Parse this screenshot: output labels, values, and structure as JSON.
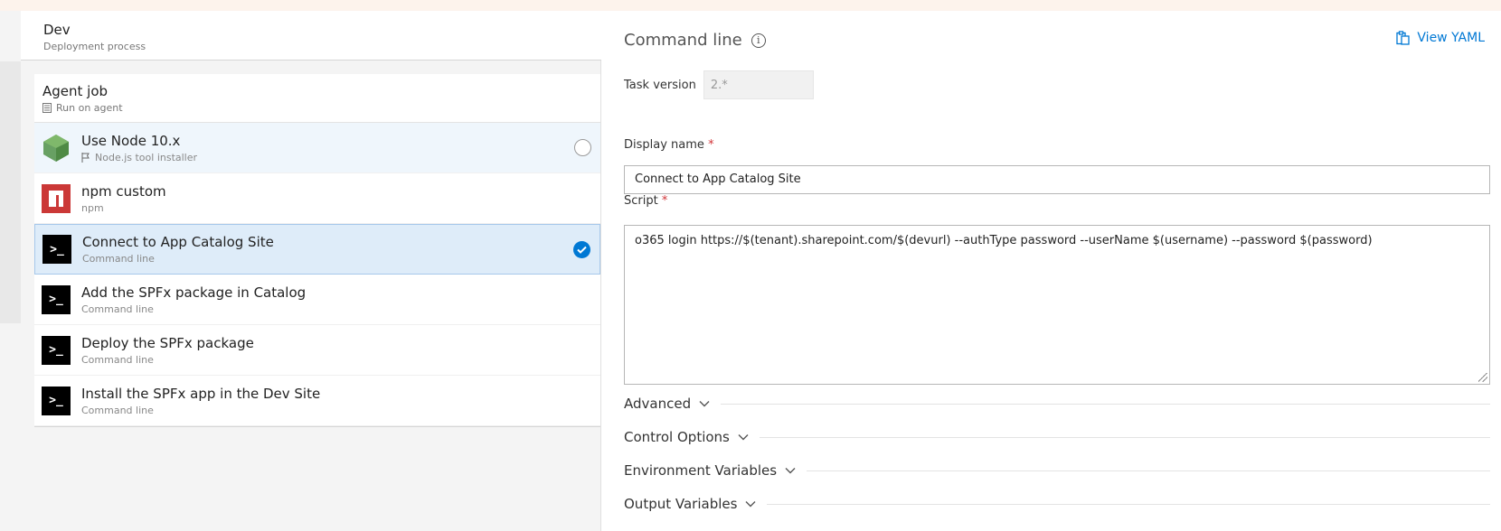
{
  "environment": {
    "title": "Dev",
    "subtitle": "Deployment process"
  },
  "agent_job": {
    "title": "Agent job",
    "subtitle": "Run on agent"
  },
  "tasks": [
    {
      "name": "Use Node 10.x",
      "type": "Node.js tool installer",
      "icon": "nodejs-icon",
      "state": "hover"
    },
    {
      "name": "npm custom",
      "type": "npm",
      "icon": "npm-icon",
      "state": "normal"
    },
    {
      "name": "Connect to App Catalog Site",
      "type": "Command line",
      "icon": "command-line-icon",
      "state": "selected"
    },
    {
      "name": "Add the SPFx package in Catalog",
      "type": "Command line",
      "icon": "command-line-icon",
      "state": "normal"
    },
    {
      "name": "Deploy the SPFx package",
      "type": "Command line",
      "icon": "command-line-icon",
      "state": "normal"
    },
    {
      "name": "Install the SPFx app in the Dev Site",
      "type": "Command line",
      "icon": "command-line-icon",
      "state": "normal"
    }
  ],
  "cmd_glyph": ">_",
  "panel": {
    "title": "Command line",
    "view_yaml": "View YAML",
    "task_version_label": "Task version",
    "task_version_value": "2.*",
    "display_name_label": "Display name",
    "display_name_value": "Connect to App Catalog Site",
    "script_label": "Script",
    "required_mark": "*",
    "script_value": "o365 login https://$(tenant).sharepoint.com/$(devurl) --authType password --userName $(username) --password $(password)",
    "sections": [
      "Advanced",
      "Control Options",
      "Environment Variables",
      "Output Variables"
    ]
  },
  "colors": {
    "accent": "#0078d4",
    "selected_bg": "#deecf9",
    "npm_red": "#cb3837",
    "node_green": "#68a063",
    "required": "#d13438"
  }
}
